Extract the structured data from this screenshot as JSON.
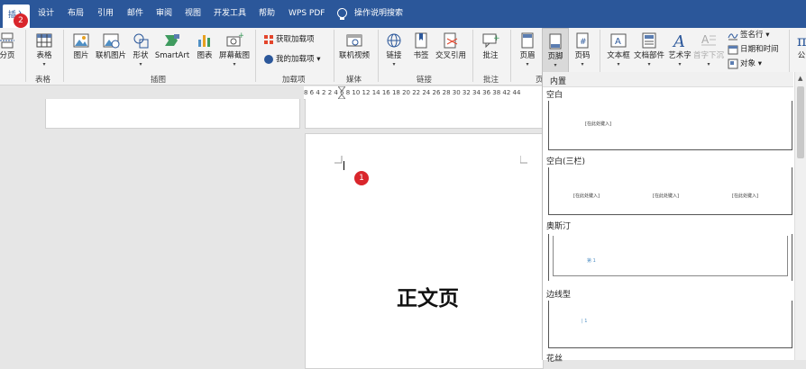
{
  "tabs": {
    "insert": "插入",
    "design": "设计",
    "layout": "布局",
    "references": "引用",
    "mailings": "邮件",
    "review": "审阅",
    "view": "视图",
    "developer": "开发工具",
    "help": "帮助",
    "wps_pdf": "WPS PDF",
    "tell_me": "操作说明搜索"
  },
  "badges": {
    "tab_badge": "2",
    "cursor_badge": "1"
  },
  "ribbon": {
    "page_break": "分页",
    "table": "表格",
    "picture": "图片",
    "online_picture": "联机图片",
    "shapes": "形状",
    "smartart": "SmartArt",
    "chart": "图表",
    "screenshot": "屏幕截图",
    "get_addins": "获取加载项",
    "my_addins": "我的加载项",
    "online_video": "联机视频",
    "link": "链接",
    "bookmark": "书签",
    "cross_ref": "交叉引用",
    "comment": "批注",
    "header": "页眉",
    "footer": "页脚",
    "page_number": "页码",
    "text_box": "文本框",
    "quick_parts": "文档部件",
    "wordart": "艺术字",
    "drop_cap": "首字下沉",
    "signature_line": "签名行",
    "date_time": "日期和时间",
    "object": "对象",
    "equation_partial": "公",
    "groups": {
      "tables": "表格",
      "illustrations": "插图",
      "addins": "加载项",
      "media": "媒体",
      "links": "链接",
      "comments": "批注",
      "header_footer_partial": "页"
    }
  },
  "ruler": {
    "numbers": "8  6  4  2     2  4  6  8  10 12 14 16 18 20 22 24 26 28 30 32 34 36 38     42  44"
  },
  "document": {
    "body_text": "正文页"
  },
  "gallery": {
    "header": "内置",
    "items": [
      {
        "title": "空白",
        "placeholders": [
          "[在此处键入]"
        ]
      },
      {
        "title": "空白(三栏)",
        "placeholders": [
          "[在此处键入]",
          "[在此处键入]",
          "[在此处键入]"
        ]
      },
      {
        "title": "奥斯汀",
        "page_mark": "第 1"
      },
      {
        "title": "边线型",
        "page_mark": "| 1"
      },
      {
        "title": "花丝"
      }
    ]
  },
  "colors": {
    "tab_bar": "#2b579a",
    "badge": "#d9262c",
    "ribbon_bg": "#f3f3f3"
  }
}
